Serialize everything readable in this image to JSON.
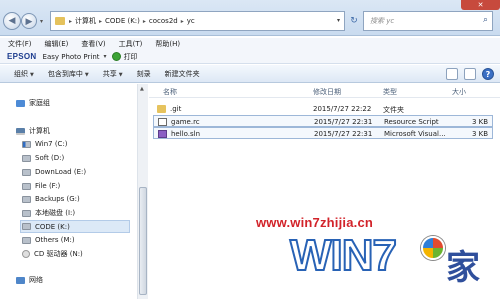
{
  "address_bar": {
    "segments": [
      "计算机",
      "CODE (K:)",
      "cocos2d",
      "yc"
    ],
    "search_placeholder": "搜索 yc"
  },
  "menu": [
    "文件(F)",
    "编辑(E)",
    "查看(V)",
    "工具(T)",
    "帮助(H)"
  ],
  "epson_bar": {
    "logo": "EPSON",
    "app": "Easy Photo Print",
    "print": "打印"
  },
  "commands": [
    "组织",
    "包含到库中",
    "共享",
    "刻录",
    "新建文件夹"
  ],
  "nav": {
    "homegroup": "家庭组",
    "computer": "计算机",
    "drives": [
      "Win7 (C:)",
      "Soft (D:)",
      "DownLoad (E:)",
      "File (F:)",
      "Backups (G:)",
      "本地磁盘 (I:)",
      "CODE (K:)",
      "Others (M:)",
      "CD 驱动器 (N:)"
    ],
    "network": "网络"
  },
  "columns": {
    "name": "名称",
    "date": "修改日期",
    "type": "类型",
    "size": "大小"
  },
  "files": [
    {
      "name": ".git",
      "date": "2015/7/27 22:22",
      "type": "文件夹",
      "size": "",
      "icon": "folder-icon"
    },
    {
      "name": "game.rc",
      "date": "2015/7/27 22:31",
      "type": "Resource Script",
      "size": "3 KB",
      "icon": "resource-script-icon"
    },
    {
      "name": "hello.sln",
      "date": "2015/7/27 22:31",
      "type": "Microsoft Visual...",
      "size": "3 KB",
      "icon": "visual-studio-solution-icon"
    }
  ],
  "watermark": {
    "url": "www.win7zhijia.cn",
    "logo": "WIN7",
    "suffix": "家"
  }
}
